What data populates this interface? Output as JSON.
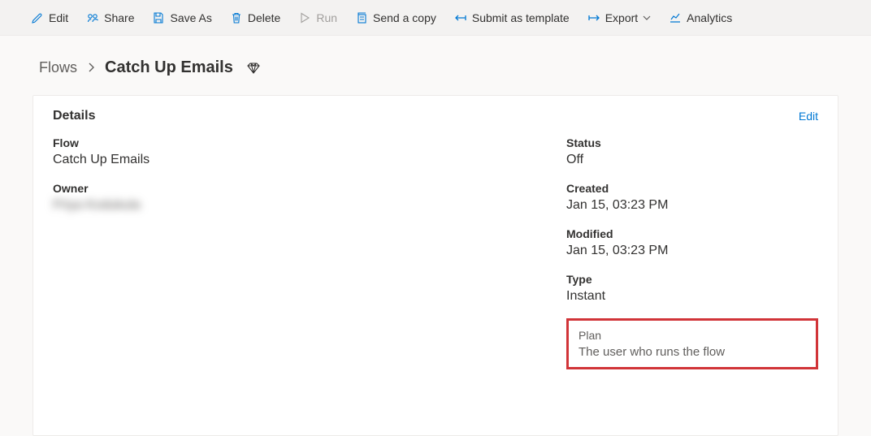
{
  "toolbar": {
    "edit": "Edit",
    "share": "Share",
    "saveAs": "Save As",
    "delete": "Delete",
    "run": "Run",
    "sendCopy": "Send a copy",
    "submitTemplate": "Submit as template",
    "export": "Export",
    "analytics": "Analytics"
  },
  "breadcrumb": {
    "root": "Flows",
    "current": "Catch Up Emails"
  },
  "card": {
    "title": "Details",
    "editLink": "Edit"
  },
  "details": {
    "flowLabel": "Flow",
    "flowValue": "Catch Up Emails",
    "ownerLabel": "Owner",
    "ownerValue": "Priya Kodukula",
    "statusLabel": "Status",
    "statusValue": "Off",
    "createdLabel": "Created",
    "createdValue": "Jan 15, 03:23 PM",
    "modifiedLabel": "Modified",
    "modifiedValue": "Jan 15, 03:23 PM",
    "typeLabel": "Type",
    "typeValue": "Instant",
    "planLabel": "Plan",
    "planValue": "The user who runs the flow"
  }
}
